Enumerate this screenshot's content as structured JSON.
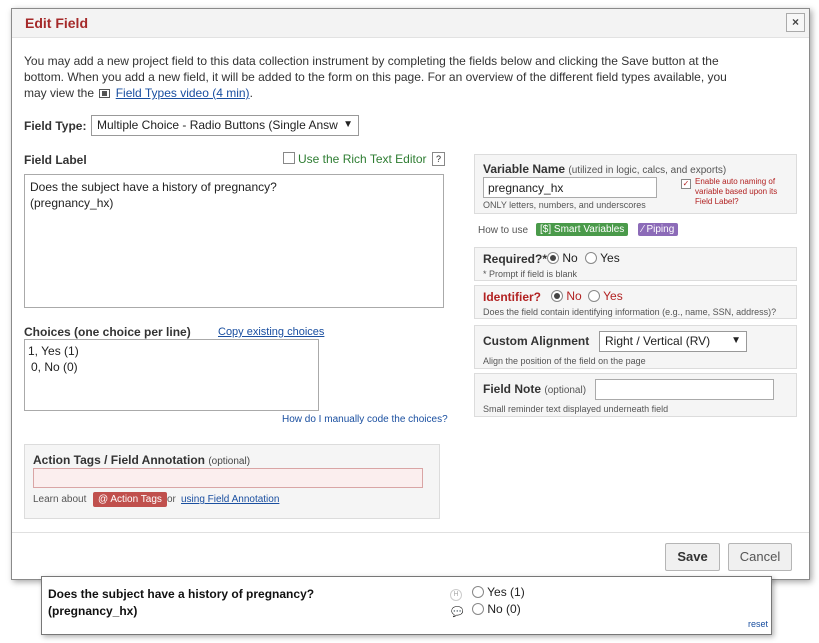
{
  "dialog": {
    "title": "Edit Field",
    "close_label": "×",
    "intro_text": "You may add a new project field to this data collection instrument by completing the fields below and clicking the Save button at the bottom. When you add a new field, it will be added to the form on this page. For an overview of the different field types available, you may view the",
    "intro_link": "Field Types video (4 min)",
    "intro_end": "."
  },
  "field_type": {
    "label": "Field Type:",
    "value": "Multiple Choice - Radio Buttons (Single Answ"
  },
  "field_label": {
    "label": "Field Label",
    "rich_text_label": "Use the Rich Text Editor",
    "help": "?",
    "line1": "Does the subject have a history of pregnancy?",
    "line2": "(pregnancy_hx)"
  },
  "choices": {
    "label": "Choices (one choice per line)",
    "copy_link": "Copy existing choices",
    "line1": "1, Yes (1)",
    "line2": "0, No (0)",
    "manual_link": "How do I manually code the choices?"
  },
  "action_tags": {
    "label": "Action Tags / Field Annotation",
    "optional": "(optional)",
    "learn": "Learn about",
    "button": "@ Action Tags",
    "or": "or",
    "annotation_link": "using Field Annotation"
  },
  "variable": {
    "label": "Variable Name",
    "hint": "(utilized in logic, calcs, and exports)",
    "value": "pregnancy_hx",
    "rule": "ONLY letters, numbers, and underscores",
    "auto_name": "Enable auto naming of variable based upon its Field Label?"
  },
  "how_to_use": {
    "label": "How to use",
    "smart": "[$] Smart Variables",
    "piping": "Piping"
  },
  "required": {
    "label": "Required?*",
    "no": "No",
    "yes": "Yes",
    "note": "* Prompt if field is blank"
  },
  "identifier": {
    "label": "Identifier?",
    "no": "No",
    "yes": "Yes",
    "note": "Does the field contain identifying information (e.g., name, SSN, address)?"
  },
  "alignment": {
    "label": "Custom Alignment",
    "value": "Right / Vertical (RV)",
    "note": "Align the position of the field on the page"
  },
  "field_note": {
    "label": "Field Note",
    "optional": "(optional)",
    "note": "Small reminder text displayed underneath field"
  },
  "footer": {
    "save": "Save",
    "cancel": "Cancel"
  },
  "preview": {
    "question": "Does the subject have a history of pregnancy?",
    "variable": "(pregnancy_hx)",
    "choice1": "Yes (1)",
    "choice2": "No (0)",
    "h_icon": "H",
    "reset": "reset"
  }
}
